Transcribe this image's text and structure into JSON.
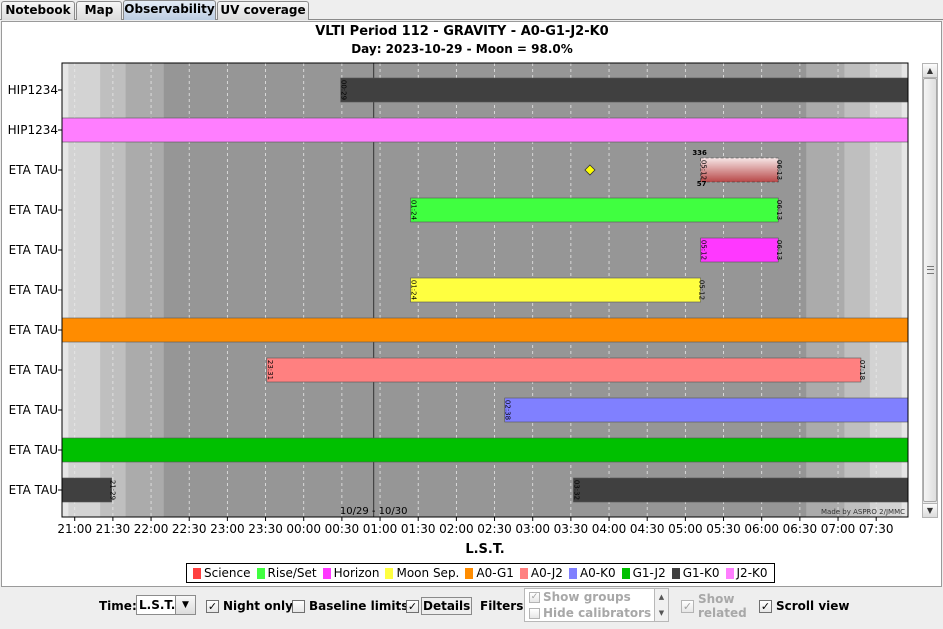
{
  "tabs": [
    "Notebook",
    "Map",
    "Observability",
    "UV coverage"
  ],
  "active_tab": "Observability",
  "chart": {
    "title": "VLTI Period 112 - GRAVITY - A0-G1-J2-K0",
    "subtitle": "Day: 2023-10-29 - Moon = 98.0%",
    "xlabel": "L.S.T.",
    "date_change_label": "10/29 - 10/30",
    "credit": "Made by ASPRO 2/JMMC",
    "xticks": [
      "21:00",
      "21:30",
      "22:00",
      "22:30",
      "23:00",
      "23:30",
      "00:00",
      "00:30",
      "01:00",
      "01:30",
      "02:00",
      "02:30",
      "03:00",
      "03:30",
      "04:00",
      "04:30",
      "05:00",
      "05:30",
      "06:00",
      "06:30",
      "07:00",
      "07:30"
    ],
    "rows": [
      "HIP1234",
      "HIP1234",
      "ETA TAU",
      "ETA TAU",
      "ETA TAU",
      "ETA TAU",
      "ETA TAU",
      "ETA TAU",
      "ETA TAU",
      "ETA TAU",
      "ETA TAU"
    ]
  },
  "chart_data": {
    "type": "bar",
    "x_axis": "L.S.T.",
    "xlim": [
      "20:50",
      "07:55"
    ],
    "bars": [
      {
        "row": 0,
        "start": "00:29",
        "end": "07:55",
        "color": "#404040",
        "labels": [
          "00:29"
        ]
      },
      {
        "row": 1,
        "start": "20:50",
        "end": "07:55",
        "color": "#ff7eff",
        "labels": []
      },
      {
        "row": 2,
        "start": "05:12",
        "end": "06:13",
        "color": "gradient",
        "labels": [
          "336",
          "05:12",
          "06:13",
          "57"
        ],
        "marker": "03:45"
      },
      {
        "row": 3,
        "start": "01:24",
        "end": "06:13",
        "color": "#40ff40",
        "labels": [
          "01:24",
          "06:13"
        ]
      },
      {
        "row": 4,
        "start": "05:12",
        "end": "06:13",
        "color": "#ff38ff",
        "labels": [
          "05:12",
          "06:13"
        ]
      },
      {
        "row": 5,
        "start": "01:24",
        "end": "05:12",
        "color": "#ffff40",
        "labels": [
          "01:24",
          "05:12"
        ]
      },
      {
        "row": 6,
        "start": "20:50",
        "end": "07:55",
        "color": "#ff8c00",
        "labels": []
      },
      {
        "row": 7,
        "start": "23:31",
        "end": "07:18",
        "color": "#ff8080",
        "labels": [
          "23:31",
          "07:18"
        ]
      },
      {
        "row": 8,
        "start": "02:38",
        "end": "07:55",
        "color": "#8080ff",
        "labels": [
          "02:38"
        ]
      },
      {
        "row": 9,
        "start": "20:50",
        "end": "07:55",
        "color": "#00c000",
        "labels": []
      },
      {
        "row": 10,
        "start": "20:50",
        "end": "21:29",
        "color": "#404040",
        "labels": [
          "21:29"
        ]
      },
      {
        "row": 10,
        "start": "03:32",
        "end": "07:55",
        "color": "#404040",
        "labels": [
          "03:32"
        ]
      }
    ]
  },
  "legend": [
    {
      "label": "Science",
      "color": "#ff4040"
    },
    {
      "label": "Rise/Set",
      "color": "#40ff40"
    },
    {
      "label": "Horizon",
      "color": "#ff38ff"
    },
    {
      "label": "Moon Sep.",
      "color": "#ffff40"
    },
    {
      "label": "A0-G1",
      "color": "#ff8c00"
    },
    {
      "label": "A0-J2",
      "color": "#ff8080"
    },
    {
      "label": "A0-K0",
      "color": "#8080ff"
    },
    {
      "label": "G1-J2",
      "color": "#00c000"
    },
    {
      "label": "G1-K0",
      "color": "#404040"
    },
    {
      "label": "J2-K0",
      "color": "#ff7eff"
    }
  ],
  "controls": {
    "time_label": "Time:",
    "time_value": "L.S.T.",
    "night_only": "Night only",
    "baseline_limits": "Baseline limits",
    "details": "Details",
    "filters_label": "Filters:",
    "show_groups": "Show groups",
    "hide_calibrators": "Hide calibrators",
    "show_related": "Show related",
    "scroll_view": "Scroll view"
  }
}
